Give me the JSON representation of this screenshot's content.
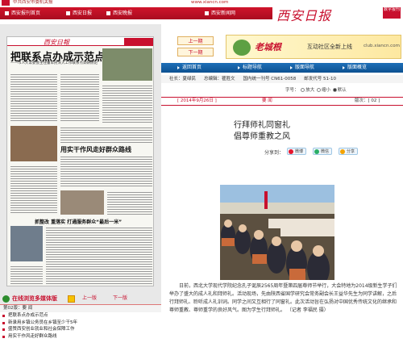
{
  "header": {
    "site_name": "中共西安市委机关报",
    "url": "www.xiancn.com",
    "nav": [
      "西安报刊首页",
      "西安日报",
      "西安晚报",
      "西安新闻网"
    ],
    "brand_name": "西安日报",
    "brand_badge": "数字报刊"
  },
  "left_panel": {
    "newspaper_headline": "把联系点办成示范点",
    "newspaper_sub": "——市人大常委会主任董军民深入工作联系点调研侧记",
    "newspaper_head2": "用实干作风走好群众路线",
    "newspaper_head3": "抓整改 重落实 打通服务群众“最后一米”",
    "section_title": "在线浏览多媒体版",
    "prev_page": "上一版",
    "next_page": "下一版",
    "page_label": "第02版：要 闻",
    "list": [
      "把联系点办成示范点",
      "新录用乡镇公务员在乡镇至少干5年",
      "盛赞西安创业就业和社会保障工作",
      "用实干作风走好群众路线"
    ]
  },
  "right_panel": {
    "prev_page": "上一期",
    "next_page": "下一期",
    "ad_brand": "老城根",
    "ad_text": "互动社区全新上线",
    "ad_url": "club.xiancn.com",
    "subnav": [
      "返回首页",
      "标题导航",
      "版面导航",
      "版面概览"
    ],
    "meta": [
      "社长：夏绿民",
      "总编辑：瞿胜文",
      "国内统一刊号 CN61-0058",
      "邮发代号 51-10"
    ],
    "font_size_label": "字号：",
    "font_options": [
      "放大",
      "缩小",
      "默认"
    ],
    "date": "[ 2014年9月26日 ]",
    "section": "要  闻",
    "page_no": "版次：[ 02 ]",
    "title_line1": "行拜师礼同窗礼",
    "title_line2": "倡尊师重教之风",
    "share_label": "分享到：",
    "share_buttons": [
      "微博",
      "微信",
      "分享"
    ],
    "body": "日前，西北大学现代学院纪念孔子诞辰2565周年暨第四届尊师节举行，大会特地为2014级新生学子们举办了盛大的成人礼和拜师礼。活动现场，先由陕西省国学研究会常务副会长王益华先生为同学讲解，之后行拜师礼、聆听成人礼训词。同学之间又互相行了同窗礼。此次活动旨在弘扬对中国优秀传统文化的继承和尊师重教、尊师重学的良好风气。图为学生行拜师礼。  （记者 李福民 摄）"
  },
  "colors": {
    "accent": "#c8102e",
    "link_blue": "#1e6fb8"
  }
}
